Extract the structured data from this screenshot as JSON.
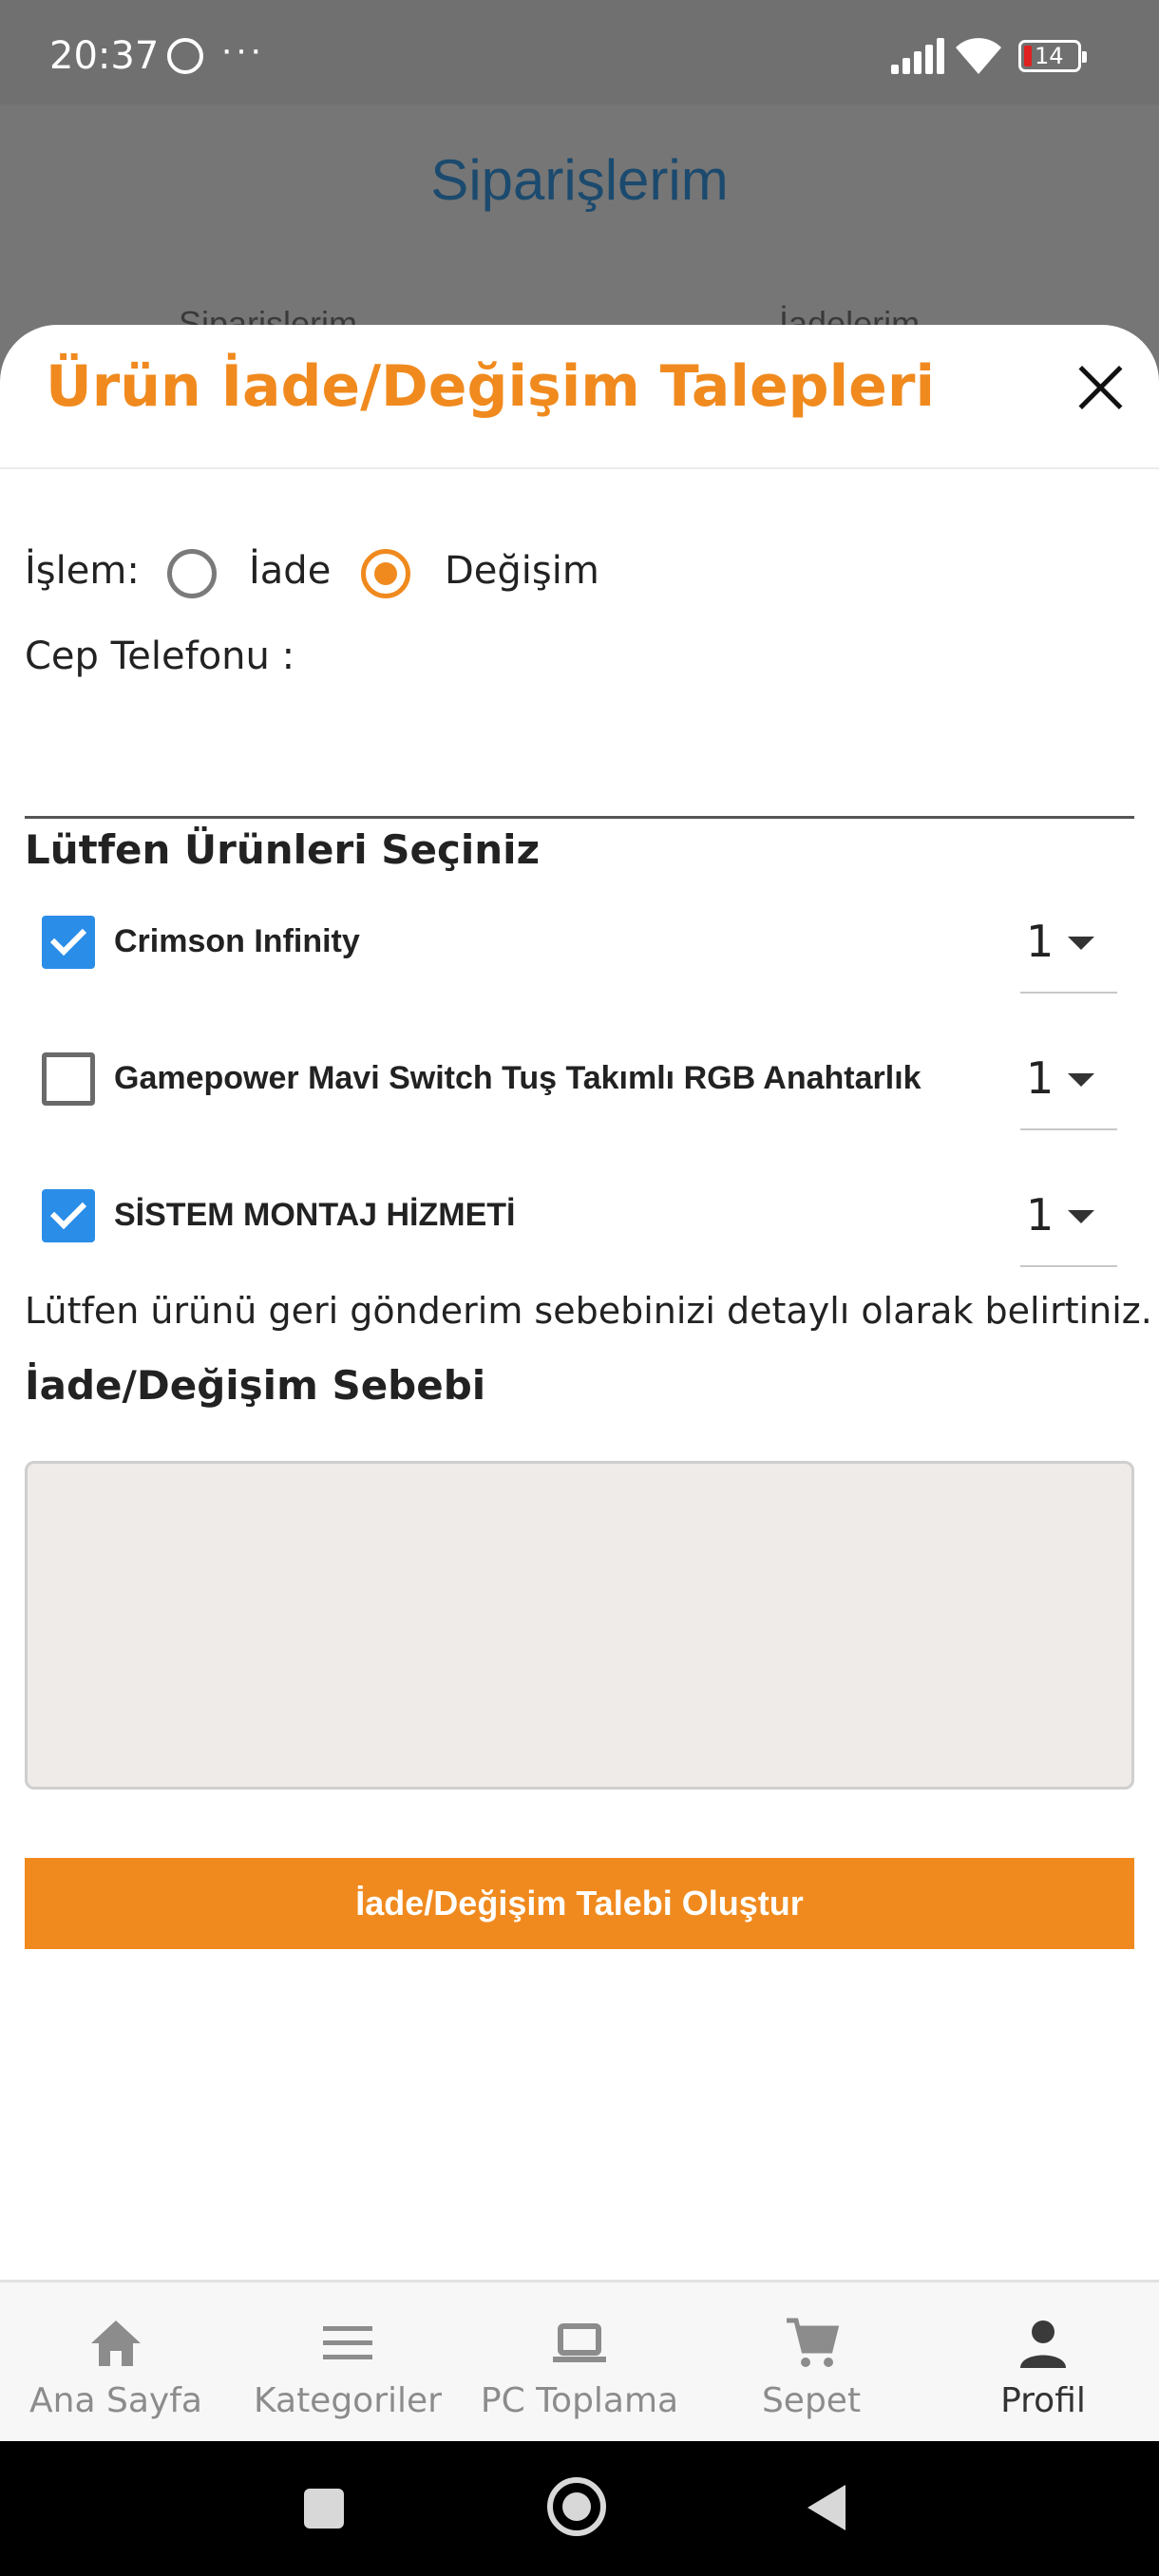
{
  "status_bar": {
    "time": "20:37",
    "more": "···",
    "battery_level": "14"
  },
  "background_page": {
    "title": "Siparişlerim",
    "tab_orders": "Siparişlerim",
    "tab_returns": "İadelerim"
  },
  "modal": {
    "title": "Ürün İade/Değişim Talepleri",
    "operation_label": "İşlem:",
    "operation_options": [
      {
        "label": "İade",
        "selected": false
      },
      {
        "label": "Değişim",
        "selected": true
      }
    ],
    "phone_label": "Cep Telefonu :",
    "phone_value": "",
    "products_title": "Lütfen Ürünleri Seçiniz",
    "products": [
      {
        "name": "Crimson Infinity",
        "checked": true,
        "quantity": "1"
      },
      {
        "name": "Gamepower Mavi Switch Tuş Takımlı RGB Anahtarlık",
        "checked": false,
        "quantity": "1"
      },
      {
        "name": "SİSTEM MONTAJ HİZMETİ",
        "checked": true,
        "quantity": "1"
      }
    ],
    "hint": "Lütfen ürünü geri gönderim sebebinizi detaylı olarak belirtiniz.",
    "reason_label": "İade/Değişim Sebebi",
    "reason_value": "",
    "submit_label": "İade/Değişim Talebi Oluştur"
  },
  "bottom_nav": {
    "items": [
      {
        "label": "Ana Sayfa",
        "icon": "home-icon",
        "active": false
      },
      {
        "label": "Kategoriler",
        "icon": "menu-icon",
        "active": false
      },
      {
        "label": "PC Toplama",
        "icon": "laptop-icon",
        "active": false
      },
      {
        "label": "Sepet",
        "icon": "cart-icon",
        "active": false
      },
      {
        "label": "Profil",
        "icon": "person-icon",
        "active": true
      }
    ]
  },
  "colors": {
    "accent": "#f08a1e",
    "checkbox": "#2a8de8",
    "title_blue": "#1b4a6e"
  }
}
